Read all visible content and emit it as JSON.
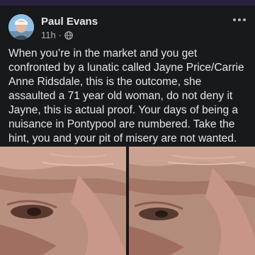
{
  "post": {
    "author": "Paul Evans",
    "time": "11h",
    "privacy_icon": "globe-icon",
    "more_icon": "more-dots-icon",
    "text": "When you’re in the market and you get confronted by a lunatic called Jayne Price/Carrie Anne Ridsdale, this is the outcome, she assaulted a 71 year old woman, do not deny it Jayne, this is actual proof. Your days of being a nuisance in Pontypool are numbered. Take the hint, you and your pit of misery are not wanted.",
    "photos": [
      "injury-photo-1",
      "injury-photo-2"
    ]
  },
  "colors": {
    "background": "#18191a",
    "text": "#e4e6eb",
    "secondary_text": "#b0b3b8",
    "header_strip": "#2a2240"
  }
}
